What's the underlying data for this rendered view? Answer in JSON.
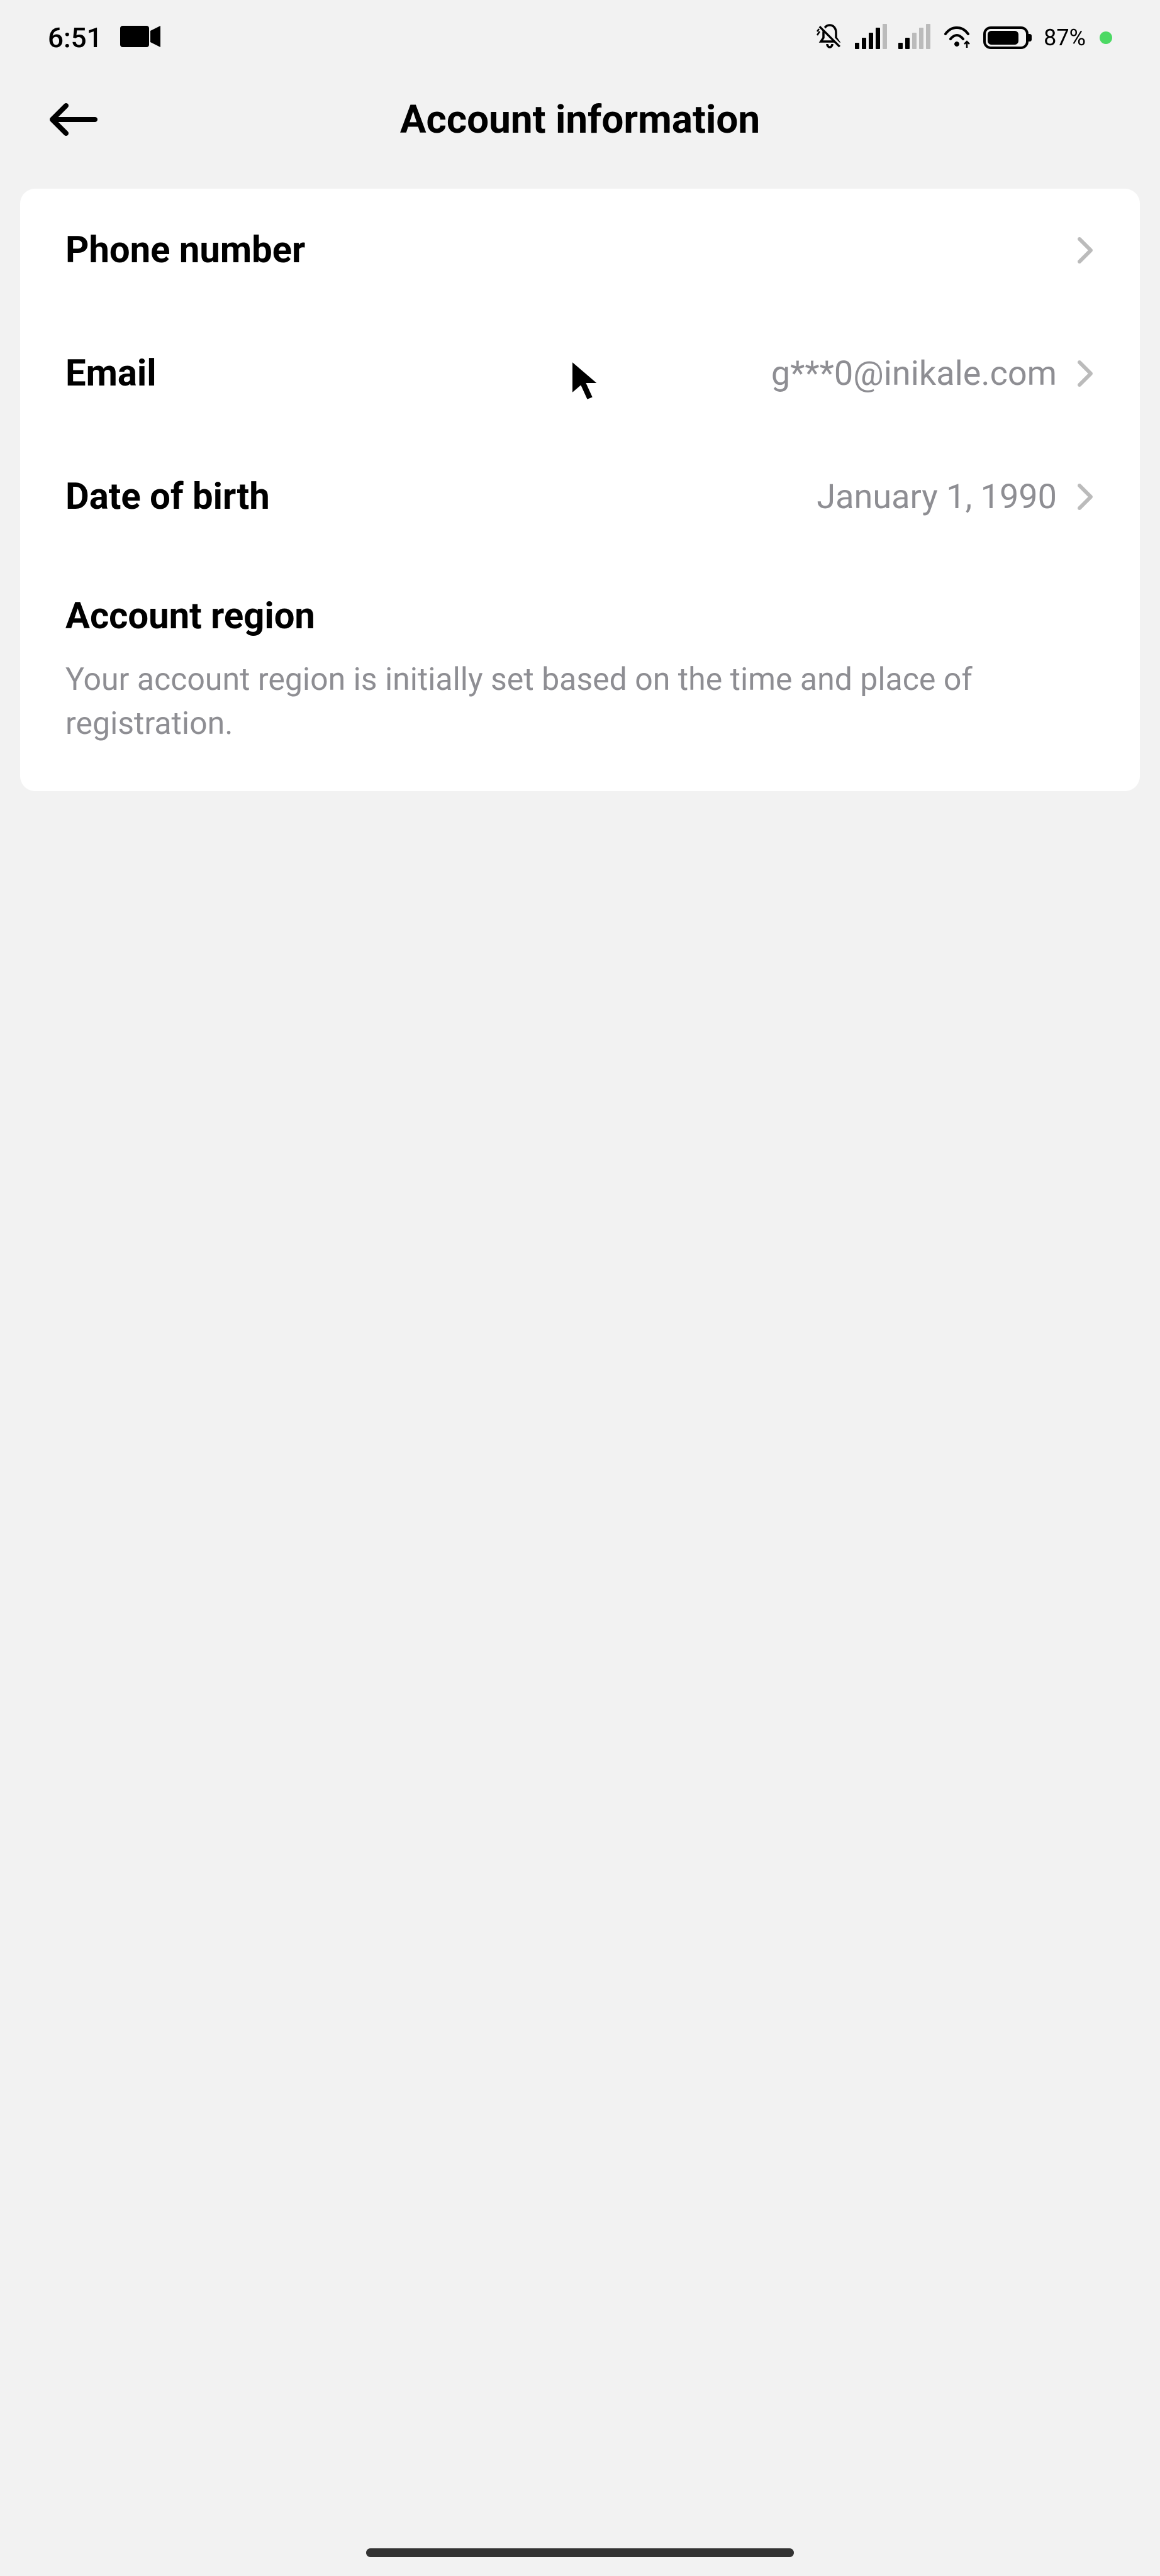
{
  "status_bar": {
    "time": "6:51",
    "battery_percent": "87%"
  },
  "header": {
    "title": "Account information"
  },
  "items": {
    "phone": {
      "label": "Phone number",
      "value": ""
    },
    "email": {
      "label": "Email",
      "value": "g***0@inikale.com"
    },
    "dob": {
      "label": "Date of birth",
      "value": "January 1, 1990"
    }
  },
  "region": {
    "title": "Account region",
    "description": "Your account region is initially set based on the time and place of registration."
  }
}
